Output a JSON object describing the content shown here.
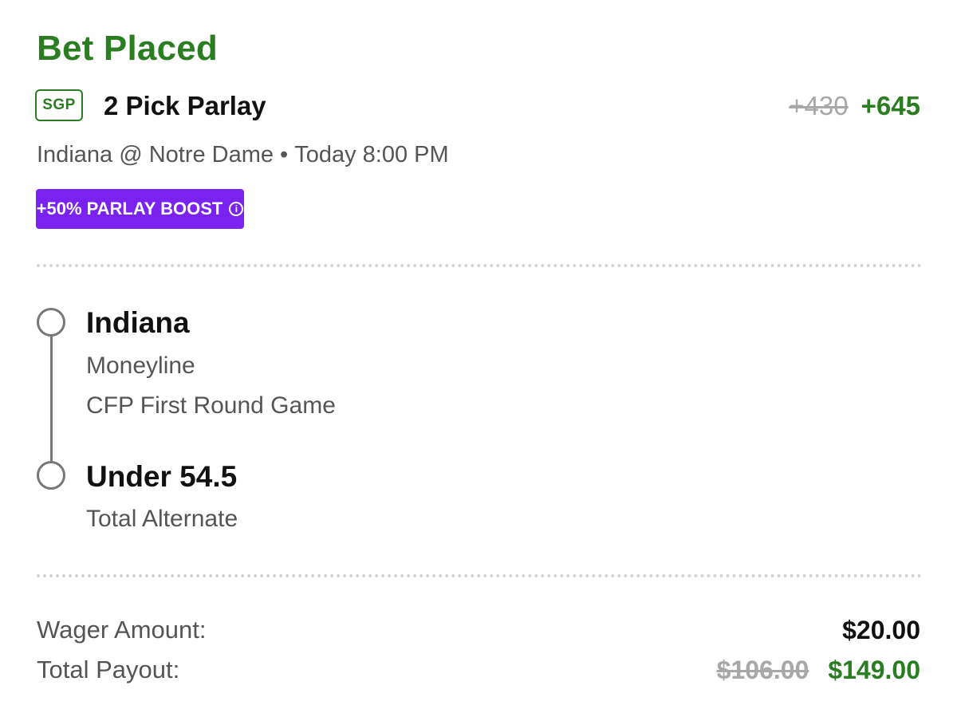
{
  "header": {
    "status": "Bet Placed"
  },
  "bet": {
    "badge": "SGP",
    "title": "2 Pick Parlay",
    "odds_original": "+430",
    "odds_boosted": "+645",
    "matchup": "Indiana @ Notre Dame",
    "separator": "•",
    "start_time": "Today 8:00 PM",
    "boost_label": "+50% PARLAY BOOST",
    "boost_info_icon": "i"
  },
  "legs": [
    {
      "selection": "Indiana",
      "market": "Moneyline",
      "event": "CFP First Round Game"
    },
    {
      "selection": "Under 54.5",
      "market": "Total Alternate"
    }
  ],
  "summary": {
    "wager_label": "Wager Amount:",
    "wager_value": "$20.00",
    "payout_label": "Total Payout:",
    "payout_original": "$106.00",
    "payout_boosted": "$149.00"
  },
  "colors": {
    "accent_green": "#2a7d21",
    "boost_purple": "#7a22f0",
    "muted_text": "#555555",
    "strike_gray": "#a8a8a8"
  },
  "icons": {
    "boost_info": "info-icon",
    "leg_marker": "circle-outline-icon"
  }
}
